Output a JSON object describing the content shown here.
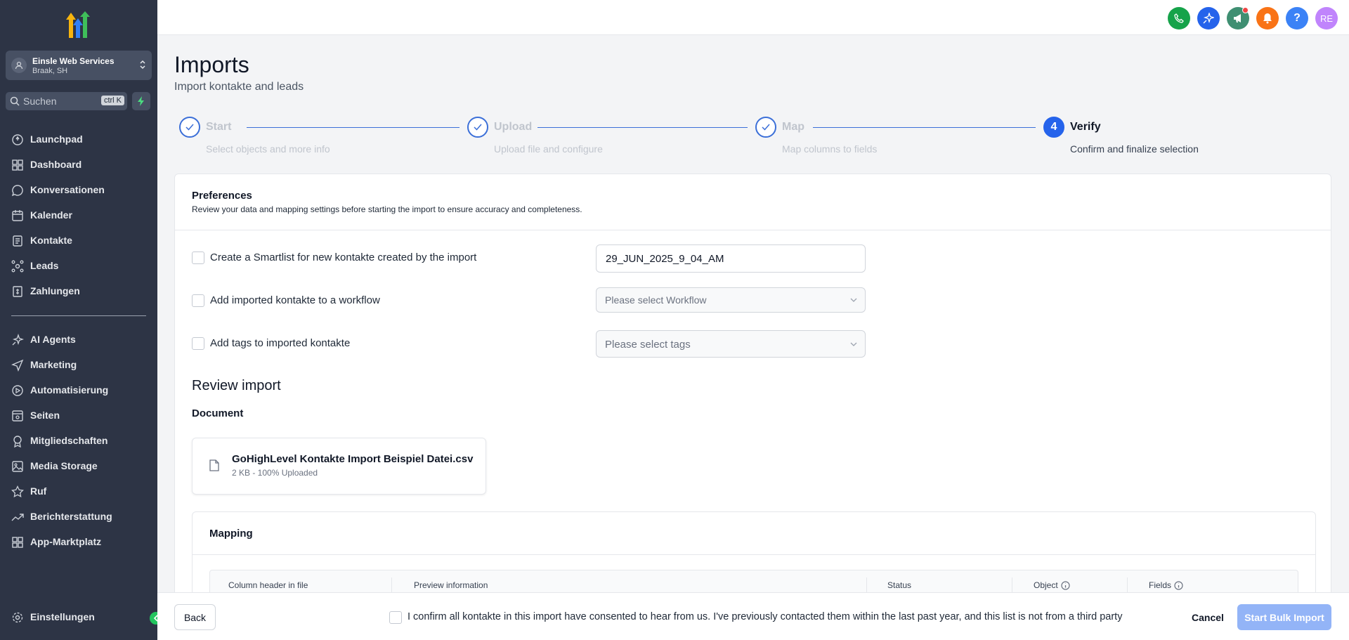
{
  "sidebar": {
    "location": {
      "name": "Einsle Web Services",
      "sub": "Braak, SH"
    },
    "search": {
      "placeholder": "Suchen",
      "shortcut": "ctrl K"
    },
    "items": [
      {
        "label": "Launchpad",
        "icon": "rocket-icon"
      },
      {
        "label": "Dashboard",
        "icon": "dashboard-icon"
      },
      {
        "label": "Konversationen",
        "icon": "chat-icon"
      },
      {
        "label": "Kalender",
        "icon": "calendar-icon"
      },
      {
        "label": "Kontakte",
        "icon": "contacts-icon"
      },
      {
        "label": "Leads",
        "icon": "leads-icon"
      },
      {
        "label": "Zahlungen",
        "icon": "payments-icon"
      }
    ],
    "items2": [
      {
        "label": "AI Agents",
        "icon": "sparkle-icon"
      },
      {
        "label": "Marketing",
        "icon": "send-icon"
      },
      {
        "label": "Automatisierung",
        "icon": "automation-icon"
      },
      {
        "label": "Seiten",
        "icon": "sites-icon"
      },
      {
        "label": "Mitgliedschaften",
        "icon": "badge-icon"
      },
      {
        "label": "Media Storage",
        "icon": "image-icon"
      },
      {
        "label": "Ruf",
        "icon": "star-icon"
      },
      {
        "label": "Berichterstattung",
        "icon": "trend-icon"
      },
      {
        "label": "App-Marktplatz",
        "icon": "apps-icon"
      }
    ],
    "settings": "Einstellungen"
  },
  "topbar": {
    "avatar_initials": "RE",
    "help": "?",
    "colors": {
      "phone": "#16a34a",
      "ai": "#2563eb",
      "megaphone": "#3f8f72",
      "bell": "#f97316",
      "help": "#3b82f6",
      "avatar": "#c084fc"
    }
  },
  "header": {
    "title": "Imports",
    "subtitle": "Import kontakte and leads"
  },
  "stepper": {
    "steps": [
      {
        "title": "Start",
        "desc": "Select objects and more info"
      },
      {
        "title": "Upload",
        "desc": "Upload file and configure"
      },
      {
        "title": "Map",
        "desc": "Map columns to fields"
      },
      {
        "title": "Verify",
        "desc": "Confirm and finalize selection",
        "number": "4"
      }
    ]
  },
  "preferences": {
    "title": "Preferences",
    "subtitle": "Review your data and mapping settings before starting the import to ensure accuracy and completeness.",
    "options": [
      {
        "label": "Create a Smartlist for new kontakte created by the import",
        "value": "29_JUN_2025_9_04_AM"
      },
      {
        "label": "Add imported kontakte to a workflow",
        "placeholder": "Please select Workflow"
      },
      {
        "label": "Add tags to imported kontakte",
        "placeholder": "Please select tags"
      }
    ]
  },
  "review": {
    "title": "Review import",
    "document_label": "Document",
    "file_name": "GoHighLevel Kontakte Import Beispiel Datei.csv",
    "file_meta": "2 KB - 100% Uploaded"
  },
  "mapping": {
    "title": "Mapping",
    "columns": [
      "Column header in file",
      "Preview information",
      "Status",
      "Object",
      "Fields"
    ]
  },
  "footer": {
    "back": "Back",
    "consent": "I confirm all kontakte in this import have consented to hear from us. I've previously contacted them within the last past year, and this list is not from a third party",
    "cancel": "Cancel",
    "start": "Start Bulk Import"
  }
}
